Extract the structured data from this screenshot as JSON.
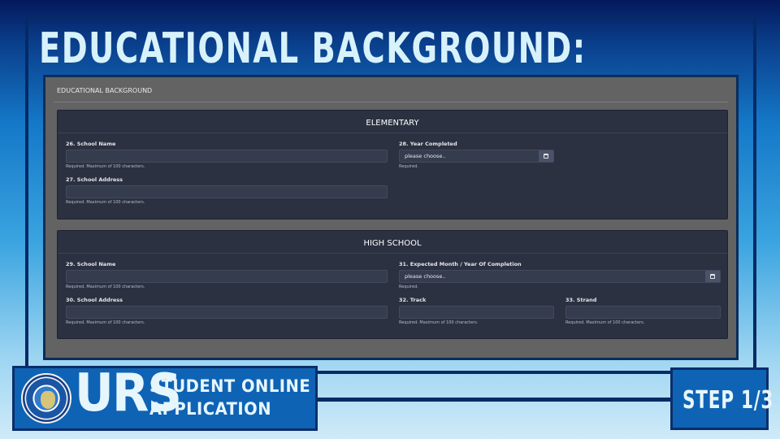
{
  "heading": "EDUCATIONAL BACKGROUND:",
  "form": {
    "title": "EDUCATIONAL BACKGROUND",
    "elementary": {
      "title": "ELEMENTARY",
      "school_name": {
        "label": "26. School Name",
        "value": "",
        "hint": "Required. Maximum of 100 characters."
      },
      "school_address": {
        "label": "27. School Address",
        "value": "",
        "hint": "Required. Maximum of 100 characters."
      },
      "year_completed": {
        "label": "28. Year Completed",
        "placeholder": "please choose..",
        "hint": "Required.",
        "icon": "calendar-icon"
      }
    },
    "high_school": {
      "title": "HIGH SCHOOL",
      "school_name": {
        "label": "29. School Name",
        "value": "",
        "hint": "Required. Maximum of 100 characters."
      },
      "school_address": {
        "label": "30. School Address",
        "value": "",
        "hint": "Required. Maximum of 100 characters."
      },
      "completion": {
        "label": "31. Expected Month / Year Of Completion",
        "placeholder": "please choose..",
        "hint": "Required.",
        "icon": "calendar-icon"
      },
      "track": {
        "label": "32. Track",
        "value": "",
        "hint": "Required. Maximum of 100 characters."
      },
      "strand": {
        "label": "33. Strand",
        "value": "",
        "hint": "Required. Maximum of 100 characters."
      }
    }
  },
  "branding": {
    "logo_text": "URS",
    "line1": "STUDENT ONLINE",
    "line2": "APPLICATION",
    "seal_icon": "university-seal-icon"
  },
  "step": "STEP 1/3",
  "colors": {
    "panel_bg": "#2b3140",
    "input_bg": "#353c4d",
    "brand_blue": "#0f63b4",
    "frame_navy": "#062a66",
    "screen_gray": "#636363"
  }
}
